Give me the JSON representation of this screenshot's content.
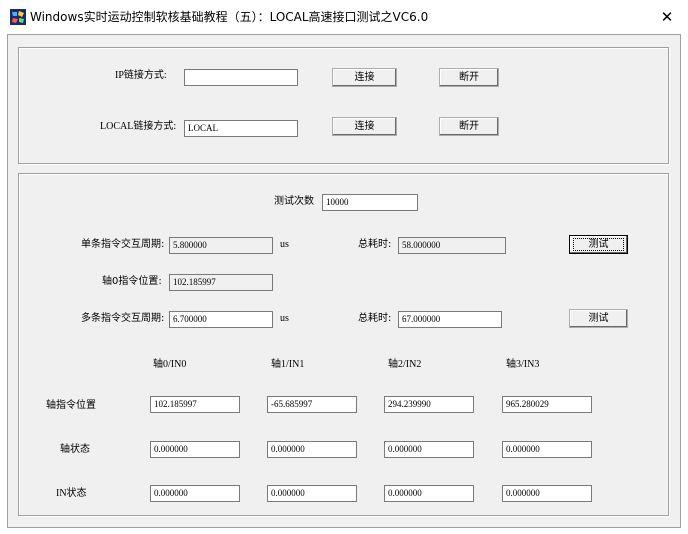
{
  "window": {
    "title": "Windows实时运动控制软核基础教程（五）：LOCAL高速接口测试之VC6.0",
    "close_glyph": "✕"
  },
  "connect": {
    "ip_label": "IP链接方式:",
    "ip_value": "",
    "ip_connect": "连接",
    "ip_disconnect": "断开",
    "local_label": "LOCAL链接方式:",
    "local_value": "LOCAL",
    "local_connect": "连接",
    "local_disconnect": "断开"
  },
  "test": {
    "count_label": "测试次数",
    "count_value": "10000",
    "single_label": "单条指令交互周期:",
    "single_value": "5.800000",
    "single_unit": "us",
    "single_total_label": "总耗时:",
    "single_total_value": "58.000000",
    "single_test_button": "测试",
    "axis0_label": "轴0指令位置:",
    "axis0_value": "102.185997",
    "multi_label": "多条指令交互周期:",
    "multi_value": "6.700000",
    "multi_unit": "us",
    "multi_total_label": "总耗时:",
    "multi_total_value": "67.000000",
    "multi_test_button": "测试"
  },
  "axes": {
    "columns": [
      "轴0/IN0",
      "轴1/IN1",
      "轴2/IN2",
      "轴3/IN3"
    ],
    "rows": [
      {
        "label": "轴指令位置",
        "values": [
          "102.185997",
          "-65.685997",
          "294.239990",
          "965.280029"
        ]
      },
      {
        "label": "轴状态",
        "values": [
          "0.000000",
          "0.000000",
          "0.000000",
          "0.000000"
        ]
      },
      {
        "label": "IN状态",
        "values": [
          "0.000000",
          "0.000000",
          "0.000000",
          "0.000000"
        ]
      }
    ]
  }
}
